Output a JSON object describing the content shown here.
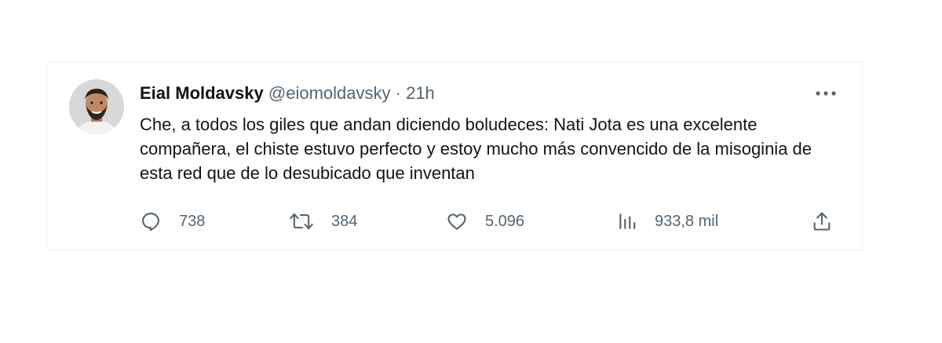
{
  "tweet": {
    "author": {
      "display_name": "Eial Moldavsky",
      "handle": "@eiomoldavsky",
      "separator": "·",
      "time": "21h",
      "avatar_icon": "profile-photo"
    },
    "text": "Che, a todos los giles que andan diciendo boludeces: Nati Jota es una excelente compañera, el chiste estuvo perfecto y estoy mucho más convencido de la misoginia de esta red que de lo desubicado que inventan",
    "more_icon": "more-horizontal-icon",
    "actions": {
      "reply": {
        "icon": "reply-icon",
        "count": "738"
      },
      "retweet": {
        "icon": "retweet-icon",
        "count": "384"
      },
      "like": {
        "icon": "heart-icon",
        "count": "5.096"
      },
      "views": {
        "icon": "analytics-icon",
        "count": "933,8 mil"
      },
      "share": {
        "icon": "share-icon"
      }
    }
  },
  "colors": {
    "text_primary": "#0f1419",
    "text_secondary": "#536471",
    "border": "#eff3f4"
  }
}
